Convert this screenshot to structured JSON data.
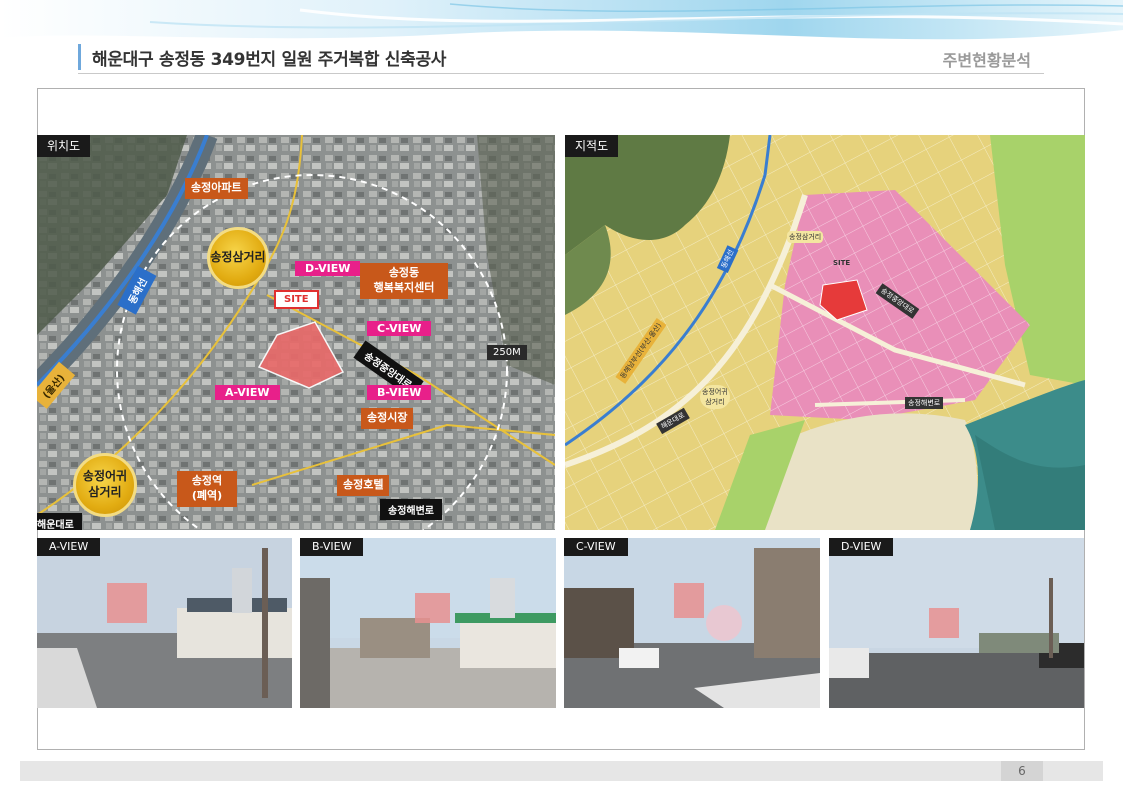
{
  "header": {
    "title": "해운대구 송정동 349번지 일원 주거복합 신축공사",
    "section": "주변현황분석"
  },
  "location_map": {
    "label": "위치도",
    "places": {
      "songjeong_apt": "송정아파트",
      "samgeori": "송정삼거리",
      "welfare_line1": "송정동",
      "welfare_line2": "행복복지센터",
      "market": "송정시장",
      "station_line1": "송정역",
      "station_line2": "(폐역)",
      "hotel": "송정호텔",
      "eogwi_line1": "송정어귀",
      "eogwi_line2": "삼거리"
    },
    "roads": {
      "jungang": "송정중앙대로",
      "haebyeon": "송정해변로",
      "haeundae": "해운대로",
      "donghae": "동해선",
      "donghae_left": "(울산)"
    },
    "site": "SITE",
    "radius": "250M",
    "views": {
      "a": "A-VIEW",
      "b": "B-VIEW",
      "c": "C-VIEW",
      "d": "D-VIEW"
    }
  },
  "cadastral_map": {
    "label": "지적도",
    "labels": {
      "samgeori": "송정삼거리",
      "site": "SITE",
      "jungang": "송정중앙대로",
      "donghae": "동해선",
      "donghae_line": "동해남부선(부산-울산)",
      "eogwi_line1": "송정어귀",
      "eogwi_line2": "삼거리",
      "haeundae": "해운대로",
      "haebyeon": "송정해변로"
    }
  },
  "photos": [
    {
      "label": "A-VIEW"
    },
    {
      "label": "B-VIEW"
    },
    {
      "label": "C-VIEW"
    },
    {
      "label": "D-VIEW"
    }
  ],
  "footer": {
    "page": "6"
  },
  "colors": {
    "accent_blue": "#6fa8dc",
    "tag_orange": "#c8581a",
    "tag_pink": "#e8208a",
    "site_red": "#e03030",
    "zone_yellow": "#e8d27a",
    "zone_pink": "#e98fb8",
    "zone_green": "#a7d46b",
    "sea": "#3c8c8a"
  }
}
